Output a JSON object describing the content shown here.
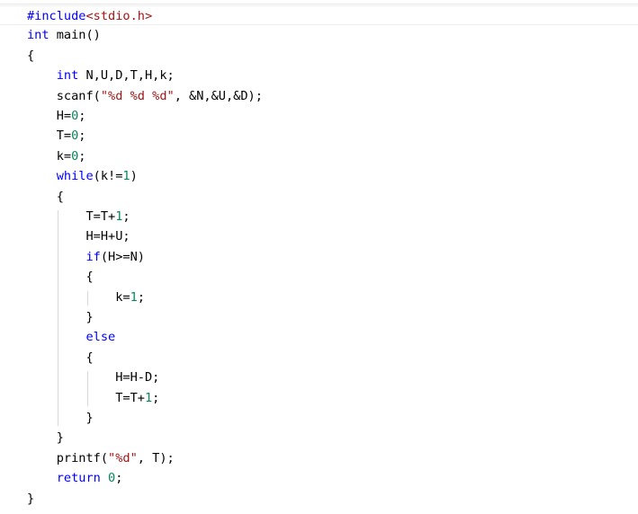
{
  "editor": {
    "language": "c",
    "lines": [
      [
        {
          "t": "#include",
          "c": "pp"
        },
        {
          "t": "<stdio.h>",
          "c": "inc"
        }
      ],
      [
        {
          "t": "int",
          "c": "kw"
        },
        {
          "t": " main()",
          "c": "plain"
        }
      ],
      [
        {
          "t": "{",
          "c": "plain"
        }
      ],
      [
        {
          "t": "    ",
          "c": "plain"
        },
        {
          "t": "int",
          "c": "kw"
        },
        {
          "t": " N,U,D,T,H,k;",
          "c": "plain"
        }
      ],
      [
        {
          "t": "    scanf(",
          "c": "plain"
        },
        {
          "t": "\"%d %d %d\"",
          "c": "str"
        },
        {
          "t": ", &N,&U,&D);",
          "c": "plain"
        }
      ],
      [
        {
          "t": "    H=",
          "c": "plain"
        },
        {
          "t": "0",
          "c": "num"
        },
        {
          "t": ";",
          "c": "plain"
        }
      ],
      [
        {
          "t": "    T=",
          "c": "plain"
        },
        {
          "t": "0",
          "c": "num"
        },
        {
          "t": ";",
          "c": "plain"
        }
      ],
      [
        {
          "t": "    k=",
          "c": "plain"
        },
        {
          "t": "0",
          "c": "num"
        },
        {
          "t": ";",
          "c": "plain"
        }
      ],
      [
        {
          "t": "    ",
          "c": "plain"
        },
        {
          "t": "while",
          "c": "kw"
        },
        {
          "t": "(k!=",
          "c": "plain"
        },
        {
          "t": "1",
          "c": "num"
        },
        {
          "t": ")",
          "c": "plain"
        }
      ],
      [
        {
          "t": "    {",
          "c": "plain"
        }
      ],
      [
        {
          "t": "        T=T+",
          "c": "plain"
        },
        {
          "t": "1",
          "c": "num"
        },
        {
          "t": ";",
          "c": "plain"
        }
      ],
      [
        {
          "t": "        H=H+U;",
          "c": "plain"
        }
      ],
      [
        {
          "t": "        ",
          "c": "plain"
        },
        {
          "t": "if",
          "c": "kw"
        },
        {
          "t": "(H>=N)",
          "c": "plain"
        }
      ],
      [
        {
          "t": "        {",
          "c": "plain"
        }
      ],
      [
        {
          "t": "            k=",
          "c": "plain"
        },
        {
          "t": "1",
          "c": "num"
        },
        {
          "t": ";",
          "c": "plain"
        }
      ],
      [
        {
          "t": "        }",
          "c": "plain"
        }
      ],
      [
        {
          "t": "        ",
          "c": "plain"
        },
        {
          "t": "else",
          "c": "kw"
        }
      ],
      [
        {
          "t": "        {",
          "c": "plain"
        }
      ],
      [
        {
          "t": "            H=H-D;",
          "c": "plain"
        }
      ],
      [
        {
          "t": "            T=T+",
          "c": "plain"
        },
        {
          "t": "1",
          "c": "num"
        },
        {
          "t": ";",
          "c": "plain"
        }
      ],
      [
        {
          "t": "        }",
          "c": "plain"
        }
      ],
      [
        {
          "t": "    }",
          "c": "plain"
        }
      ],
      [
        {
          "t": "    printf(",
          "c": "plain"
        },
        {
          "t": "\"%d\"",
          "c": "str"
        },
        {
          "t": ", T);",
          "c": "plain"
        }
      ],
      [
        {
          "t": "    ",
          "c": "plain"
        },
        {
          "t": "return",
          "c": "kw"
        },
        {
          "t": " ",
          "c": "plain"
        },
        {
          "t": "0",
          "c": "num"
        },
        {
          "t": ";",
          "c": "plain"
        }
      ],
      [
        {
          "t": "}",
          "c": "plain"
        }
      ]
    ]
  },
  "colors": {
    "keyword": "#0000ff",
    "string": "#a31515",
    "number": "#098658",
    "text": "#000000",
    "background": "#ffffff"
  }
}
